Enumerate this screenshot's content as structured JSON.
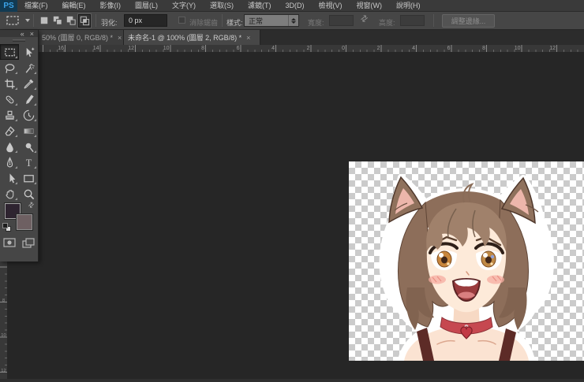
{
  "app": {
    "logo_text": "PS"
  },
  "menu": {
    "items": [
      "檔案(F)",
      "編輯(E)",
      "影像(I)",
      "圖層(L)",
      "文字(Y)",
      "選取(S)",
      "濾鏡(T)",
      "3D(D)",
      "檢視(V)",
      "視窗(W)",
      "說明(H)"
    ]
  },
  "options": {
    "tool_preset": "rectangular-marquee",
    "mode_buttons": [
      "new-selection",
      "add-to-selection",
      "subtract-from-selection",
      "intersect-selection"
    ],
    "mode_active_index": 3,
    "feather_label": "羽化:",
    "feather_value": "0 px",
    "antialias_label": "消除鋸齒",
    "antialias_checked": false,
    "style_label": "樣式:",
    "style_value": "正常",
    "width_label": "寬度:",
    "width_value": "",
    "swap_icon": "⇄",
    "height_label": "高度:",
    "height_value": "",
    "refine_edge_label": "調整邊緣..."
  },
  "tabs": {
    "items": [
      {
        "label": "50% (圖層 0, RGB/8) *",
        "close_label": "×",
        "active": false
      },
      {
        "label": "未命名-1 @ 100% (圖層 2, RGB/8) *",
        "close_label": "×",
        "active": true
      }
    ]
  },
  "tools_panel": {
    "collapse_label": "«",
    "close_label": "×",
    "foreground_color": "#2e2430",
    "background_color": "#6e6062",
    "tools": [
      {
        "name": "rectangular-marquee",
        "selected": true
      },
      {
        "name": "move",
        "selected": false
      },
      {
        "name": "lasso",
        "selected": false
      },
      {
        "name": "magic-wand",
        "selected": false
      },
      {
        "name": "crop",
        "selected": false
      },
      {
        "name": "eyedropper",
        "selected": false
      },
      {
        "name": "spot-healing-brush",
        "selected": false
      },
      {
        "name": "brush",
        "selected": false
      },
      {
        "name": "clone-stamp",
        "selected": false
      },
      {
        "name": "history-brush",
        "selected": false
      },
      {
        "name": "eraser",
        "selected": false
      },
      {
        "name": "gradient",
        "selected": false
      },
      {
        "name": "blur",
        "selected": false
      },
      {
        "name": "dodge",
        "selected": false
      },
      {
        "name": "pen",
        "selected": false
      },
      {
        "name": "type",
        "selected": false
      },
      {
        "name": "path-selection",
        "selected": false
      },
      {
        "name": "rectangle-shape",
        "selected": false
      },
      {
        "name": "hand",
        "selected": false
      },
      {
        "name": "zoom",
        "selected": false
      }
    ]
  },
  "rulers": {
    "horizontal": {
      "labels": [
        "16",
        "14",
        "12",
        "10",
        "8",
        "6",
        "4",
        "2",
        "0",
        "2",
        "4",
        "6",
        "8",
        "10",
        "12"
      ]
    },
    "vertical": {
      "labels": [
        "8",
        "10",
        "12"
      ]
    }
  },
  "canvas": {
    "artwork_alt": "Anime cat girl with brown hair, cat ears, amber eyes, open smile, red heart choker, on transparent checkerboard"
  },
  "colors": {
    "logo_blue": "#3ba3e8",
    "ui_background": "#464646",
    "pasteboard": "#262626"
  }
}
